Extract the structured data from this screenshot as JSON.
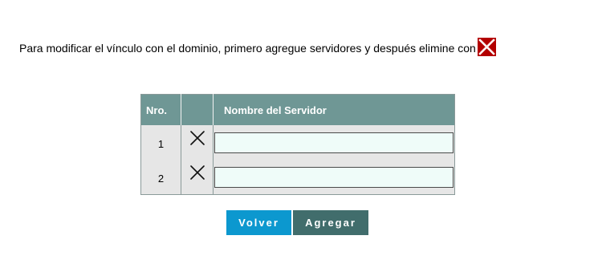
{
  "instruction": {
    "text": "Para modificar el vínculo con el dominio, primero agregue servidores y después elimine con",
    "icon": "delete-icon"
  },
  "table": {
    "headers": {
      "number": "Nro.",
      "action": "",
      "server_name": "Nombre del Servidor"
    },
    "rows": [
      {
        "number": "1",
        "server_value": "",
        "remove_icon": "close-icon"
      },
      {
        "number": "2",
        "server_value": "",
        "remove_icon": "close-icon"
      }
    ]
  },
  "buttons": {
    "back": "Volver",
    "add": "Agregar"
  },
  "colors": {
    "header": "#6f9795",
    "table_background": "#e6e6e6",
    "input_background": "#effcf9",
    "back_button": "#0c98cf",
    "add_button": "#416d6c",
    "delete_red": "#b30000"
  }
}
